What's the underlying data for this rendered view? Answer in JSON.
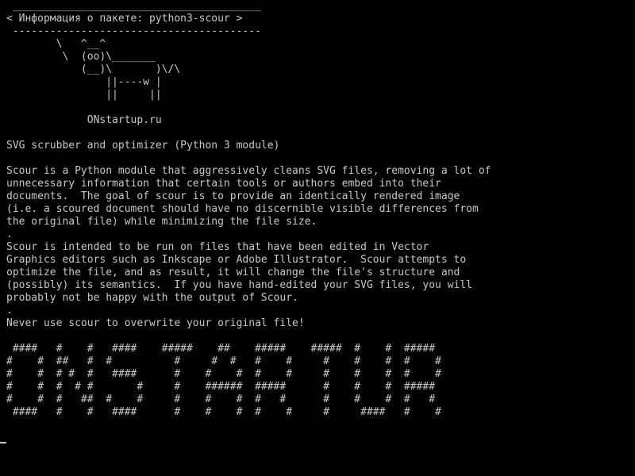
{
  "terminal": {
    "foreground": "#c8c8c8",
    "background": "#000000",
    "lines": [
      " ________________________________________",
      "< Информация о пакете: python3-scour >",
      " ----------------------------------------",
      "        \\   ^__^",
      "         \\  (oo)\\_______",
      "            (__)\\       )\\/\\",
      "                ||----w |",
      "                ||     ||",
      "",
      "             ONstartup.ru",
      "",
      "SVG scrubber and optimizer (Python 3 module)",
      "",
      "Scour is a Python module that aggressively cleans SVG files, removing a lot of",
      "unnecessary information that certain tools or authors embed into their",
      "documents.  The goal of scour is to provide an identically rendered image",
      "(i.e. a scoured document should have no discernible visible differences from",
      "the original file) while minimizing the file size.",
      ".",
      "Scour is intended to be run on files that have been edited in Vector",
      "Graphics editors such as Inkscape or Adobe Illustrator.  Scour attempts to",
      "optimize the file, and as result, it will change the file's structure and",
      "(possibly) its semantics.  If you have hand-edited your SVG files, you will",
      "probably not be happy with the output of Scour.",
      ".",
      "Never use scour to overwrite your original file!",
      "",
      " ####   #    #   ####    #####    ##    #####    #####  #    #  #####",
      "#    #  ##   #  #          #     #  #   #    #     #    #    #  #    #",
      "#    #  # #  #   ####      #    #    #  #    #     #    #    #  #    #",
      "#    #  #  # #       #     #    ######  #####      #    #    #  #####",
      "#    #  #   ##  #    #     #    #    #  #   #      #    #    #  #   #",
      " ####   #    #   ####      #    #    #  #    #     #     ####   #    #"
    ]
  }
}
